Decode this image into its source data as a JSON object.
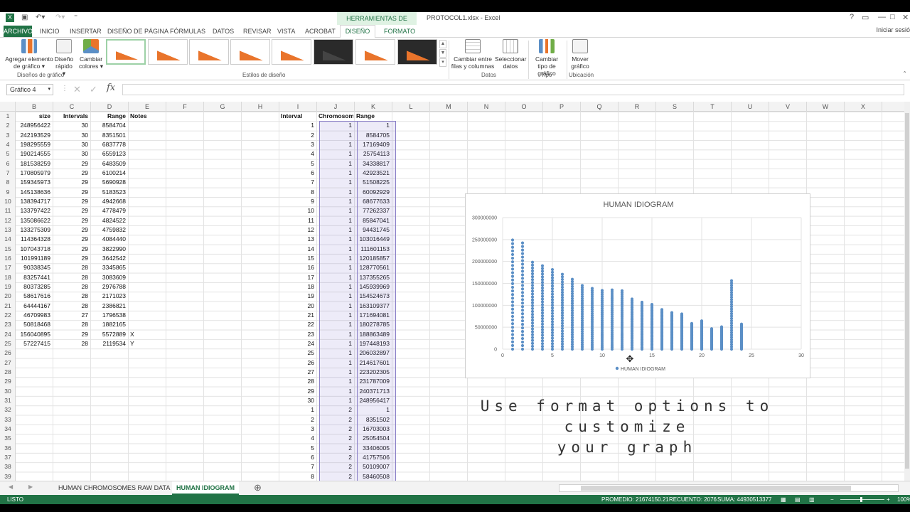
{
  "titlebar": {
    "context_tools": "HERRAMIENTAS DE GRÁFICOS",
    "doc_title": "PROTOCOL1.xlsx - Excel",
    "help": "?",
    "restore": "▭",
    "minimize": "—",
    "maximize": "□",
    "close": "✕"
  },
  "tabs": {
    "archivo": "ARCHIVO",
    "inicio": "INICIO",
    "insertar": "INSERTAR",
    "diseno_pagina": "DISEÑO DE PÁGINA",
    "formulas": "FÓRMULAS",
    "datos": "DATOS",
    "revisar": "REVISAR",
    "vista": "VISTA",
    "acrobat": "ACROBAT",
    "diseno": "DISEÑO",
    "formato": "FORMATO",
    "signin": "Iniciar sesió"
  },
  "ribbon": {
    "agregar": "Agregar elemento de gráfico ▾",
    "diseno_rapido": "Diseño rápido ▾",
    "cambiar_colores": "Cambiar colores ▾",
    "cambiar_filas": "Cambiar entre filas y columnas",
    "seleccionar_datos": "Seleccionar datos",
    "cambiar_tipo": "Cambiar tipo de gráfico",
    "mover": "Mover gráfico",
    "groups": {
      "disenos": "Diseños de gráfico",
      "estilos": "Estilos de diseño",
      "datos": "Datos",
      "tipo": "Tipo",
      "ubicacion": "Ubicación"
    },
    "colors": {
      "accent": "#217346",
      "chart_orange": "#e9742b"
    }
  },
  "formula_bar": {
    "name_box": "Gráfico 4",
    "fx": "fx",
    "value": ""
  },
  "columns": [
    "B",
    "C",
    "D",
    "E",
    "F",
    "G",
    "H",
    "I",
    "J",
    "K",
    "L",
    "M",
    "N",
    "O",
    "P",
    "Q",
    "R",
    "S",
    "T",
    "U",
    "V",
    "W",
    "X"
  ],
  "rows": [
    "1",
    "2",
    "3",
    "4",
    "5",
    "6",
    "7",
    "8",
    "9",
    "10",
    "11",
    "12",
    "13",
    "14",
    "15",
    "16",
    "17",
    "18",
    "19",
    "20",
    "21",
    "22",
    "23",
    "24",
    "25",
    "26",
    "27",
    "28",
    "29",
    "30",
    "31",
    "32",
    "33",
    "34",
    "35",
    "36",
    "37",
    "38",
    "39"
  ],
  "table_left": {
    "headers": [
      "size",
      "Intervals",
      "Range",
      "Notes"
    ],
    "rows": [
      [
        "248956422",
        "30",
        "8584704",
        ""
      ],
      [
        "242193529",
        "30",
        "8351501",
        ""
      ],
      [
        "198295559",
        "30",
        "6837778",
        ""
      ],
      [
        "190214555",
        "30",
        "6559123",
        ""
      ],
      [
        "181538259",
        "29",
        "6483509",
        ""
      ],
      [
        "170805979",
        "29",
        "6100214",
        ""
      ],
      [
        "159345973",
        "29",
        "5690928",
        ""
      ],
      [
        "145138636",
        "29",
        "5183523",
        ""
      ],
      [
        "138394717",
        "29",
        "4942668",
        ""
      ],
      [
        "133797422",
        "29",
        "4778479",
        ""
      ],
      [
        "135086622",
        "29",
        "4824522",
        ""
      ],
      [
        "133275309",
        "29",
        "4759832",
        ""
      ],
      [
        "114364328",
        "29",
        "4084440",
        ""
      ],
      [
        "107043718",
        "29",
        "3822990",
        ""
      ],
      [
        "101991189",
        "29",
        "3642542",
        ""
      ],
      [
        "90338345",
        "28",
        "3345865",
        ""
      ],
      [
        "83257441",
        "28",
        "3083609",
        ""
      ],
      [
        "80373285",
        "28",
        "2976788",
        ""
      ],
      [
        "58617616",
        "28",
        "2171023",
        ""
      ],
      [
        "64444167",
        "28",
        "2386821",
        ""
      ],
      [
        "46709983",
        "27",
        "1796538",
        ""
      ],
      [
        "50818468",
        "28",
        "1882165",
        ""
      ],
      [
        "156040895",
        "29",
        "5572889",
        "X"
      ],
      [
        "57227415",
        "28",
        "2119534",
        "Y"
      ]
    ]
  },
  "table_right": {
    "headers": [
      "Interval",
      "Chromosome",
      "Range"
    ],
    "rows": [
      [
        "1",
        "1",
        "1"
      ],
      [
        "2",
        "1",
        "8584705"
      ],
      [
        "3",
        "1",
        "17169409"
      ],
      [
        "4",
        "1",
        "25754113"
      ],
      [
        "5",
        "1",
        "34338817"
      ],
      [
        "6",
        "1",
        "42923521"
      ],
      [
        "7",
        "1",
        "51508225"
      ],
      [
        "8",
        "1",
        "60092929"
      ],
      [
        "9",
        "1",
        "68677633"
      ],
      [
        "10",
        "1",
        "77262337"
      ],
      [
        "11",
        "1",
        "85847041"
      ],
      [
        "12",
        "1",
        "94431745"
      ],
      [
        "13",
        "1",
        "103016449"
      ],
      [
        "14",
        "1",
        "111601153"
      ],
      [
        "15",
        "1",
        "120185857"
      ],
      [
        "16",
        "1",
        "128770561"
      ],
      [
        "17",
        "1",
        "137355265"
      ],
      [
        "18",
        "1",
        "145939969"
      ],
      [
        "19",
        "1",
        "154524673"
      ],
      [
        "20",
        "1",
        "163109377"
      ],
      [
        "21",
        "1",
        "171694081"
      ],
      [
        "22",
        "1",
        "180278785"
      ],
      [
        "23",
        "1",
        "188863489"
      ],
      [
        "24",
        "1",
        "197448193"
      ],
      [
        "25",
        "1",
        "206032897"
      ],
      [
        "26",
        "1",
        "214617601"
      ],
      [
        "27",
        "1",
        "223202305"
      ],
      [
        "28",
        "1",
        "231787009"
      ],
      [
        "29",
        "1",
        "240371713"
      ],
      [
        "30",
        "1",
        "248956417"
      ],
      [
        "1",
        "2",
        "1"
      ],
      [
        "2",
        "2",
        "8351502"
      ],
      [
        "3",
        "2",
        "16703003"
      ],
      [
        "4",
        "2",
        "25054504"
      ],
      [
        "5",
        "2",
        "33406005"
      ],
      [
        "6",
        "2",
        "41757506"
      ],
      [
        "7",
        "2",
        "50109007"
      ],
      [
        "8",
        "2",
        "58460508"
      ]
    ]
  },
  "chart_data": {
    "type": "scatter",
    "title": "HUMAN IDIOGRAM",
    "legend": "bottom",
    "series": [
      {
        "name": "HUMAN IDIOGRAM",
        "color": "#5b8fc6"
      }
    ],
    "x_ticks": [
      "0",
      "5",
      "10",
      "15",
      "20",
      "25",
      "30"
    ],
    "y_ticks": [
      "0",
      "50000000",
      "100000000",
      "150000000",
      "200000000",
      "250000000",
      "300000000"
    ],
    "xlim": [
      0,
      30
    ],
    "ylim": [
      0,
      300000000
    ],
    "grid": true,
    "chromosomes": [
      1,
      2,
      3,
      4,
      5,
      6,
      7,
      8,
      9,
      10,
      11,
      12,
      13,
      14,
      15,
      16,
      17,
      18,
      19,
      20,
      21,
      22,
      23,
      24
    ],
    "max_range": [
      248956422,
      242193529,
      198295559,
      190214555,
      181538259,
      170805979,
      159345973,
      145138636,
      138394717,
      133797422,
      135086622,
      133275309,
      114364328,
      107043718,
      101991189,
      90338345,
      83257441,
      80373285,
      58617616,
      64444167,
      46709983,
      50818468,
      156040895,
      57227415
    ],
    "intervals": [
      30,
      30,
      30,
      30,
      29,
      29,
      29,
      29,
      29,
      29,
      29,
      29,
      29,
      29,
      29,
      28,
      28,
      28,
      28,
      28,
      27,
      28,
      29,
      28
    ]
  },
  "caption": {
    "line1": "Use format options to customize",
    "line2": "your graph"
  },
  "sheets": {
    "raw": "HUMAN CHROMOSOMES RAW DATA",
    "idiogram": "HUMAN IDIOGRAM",
    "add": "⊕"
  },
  "status": {
    "mode": "LISTO",
    "promedio": "PROMEDIO: 21674150.21",
    "recuento": "RECUENTO: 2076",
    "suma": "SUMA: 44930513377",
    "zoom": "100%"
  }
}
